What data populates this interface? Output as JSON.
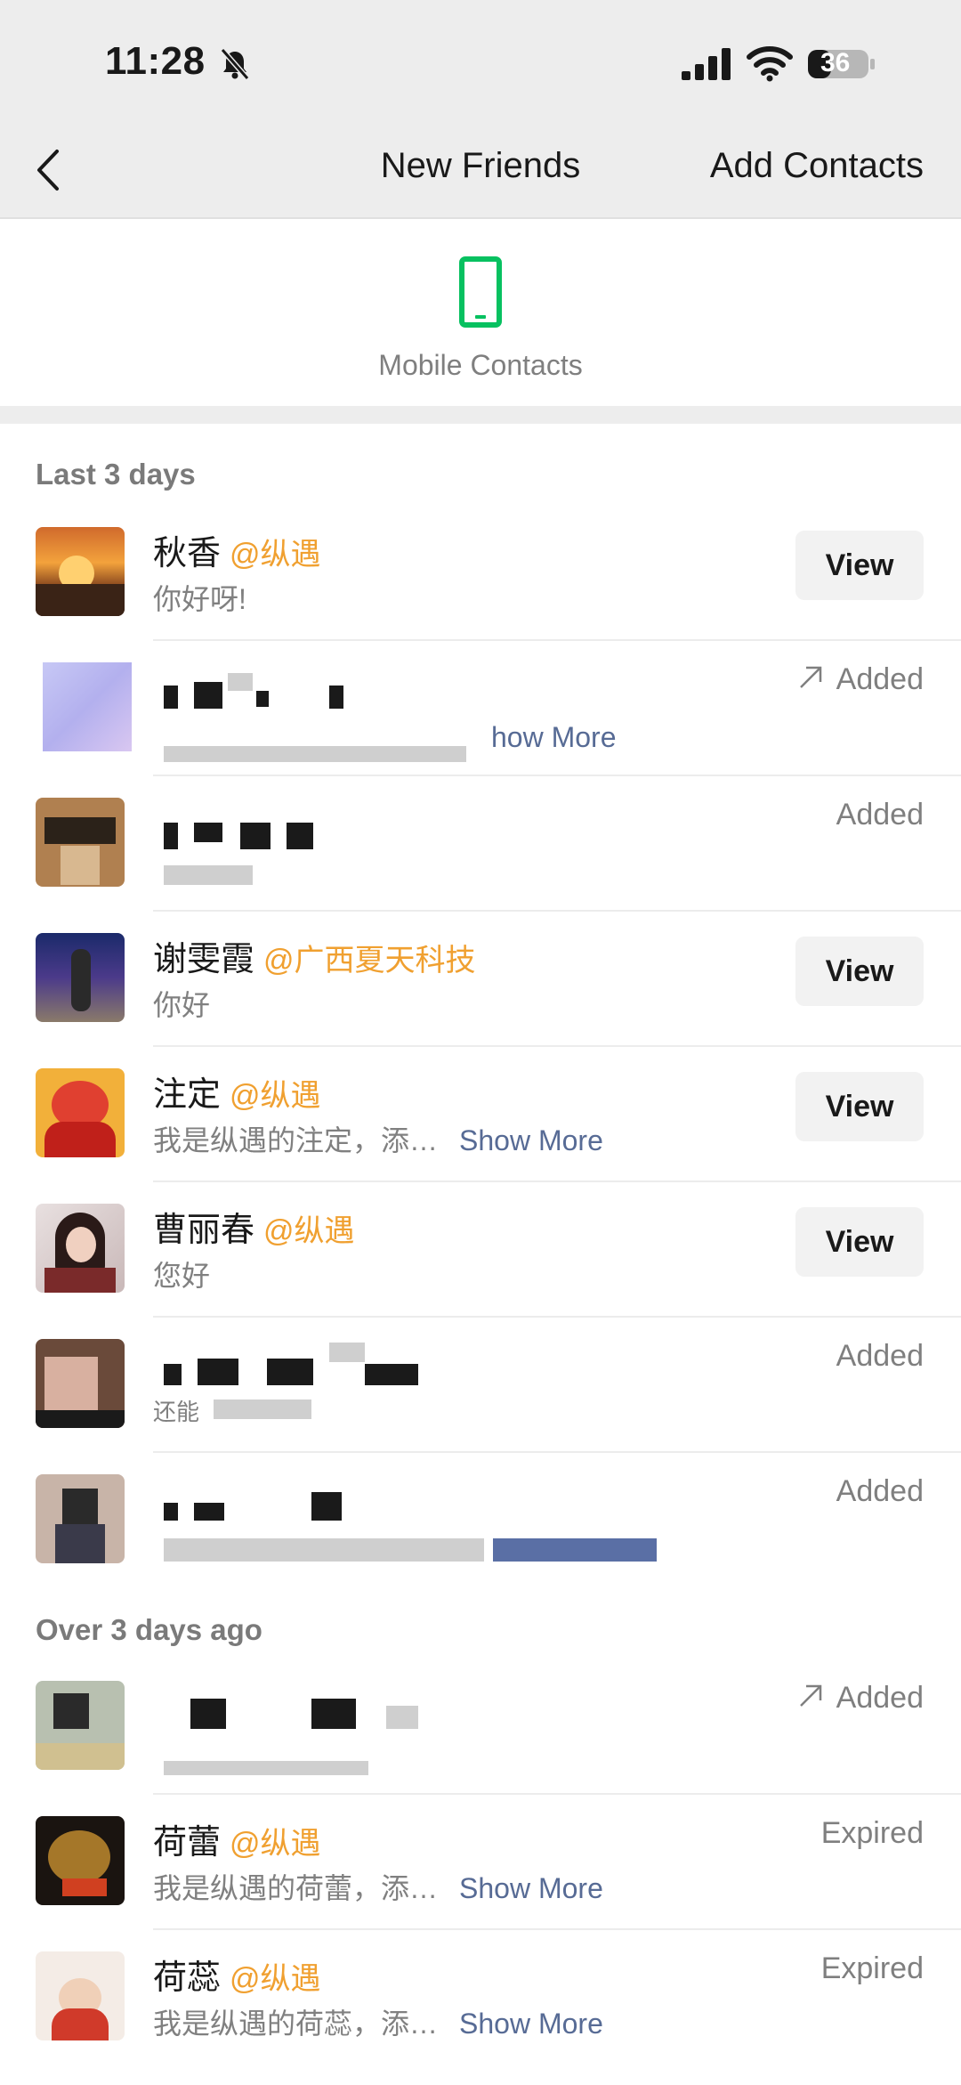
{
  "status_bar": {
    "time": "11:28",
    "battery": "36"
  },
  "nav": {
    "title": "New Friends",
    "action": "Add Contacts"
  },
  "mobile_contacts": {
    "label": "Mobile Contacts",
    "icon": "phone-icon"
  },
  "sections": {
    "recent": "Last 3 days",
    "older": "Over 3 days ago"
  },
  "rows": [
    {
      "name": "秋香",
      "org": "@纵遇",
      "message": "你好呀!",
      "action": "View"
    },
    {
      "message_more": "how More",
      "status": "Added"
    },
    {
      "status": "Added"
    },
    {
      "name": "谢雯霞",
      "org": "@广西夏天科技",
      "message": "你好",
      "action": "View"
    },
    {
      "name": "注定",
      "org": "@纵遇",
      "message": "我是纵遇的注定，添…",
      "more": "Show More",
      "action": "View"
    },
    {
      "name": "曹丽春",
      "org": "@纵遇",
      "message": "您好",
      "action": "View"
    },
    {
      "message_partial": "还能",
      "status": "Added"
    },
    {
      "status": "Added"
    },
    {
      "status": "Added"
    },
    {
      "name": "荷蕾",
      "org": "@纵遇",
      "message": "我是纵遇的荷蕾，添…",
      "more": "Show More",
      "status": "Expired"
    },
    {
      "name": "荷蕊",
      "org": "@纵遇",
      "message": "我是纵遇的荷蕊，添…",
      "more": "Show More",
      "status": "Expired"
    }
  ],
  "colors": {
    "accent_green": "#07c160",
    "org_orange": "#f0a030",
    "link_blue": "#576b95"
  }
}
